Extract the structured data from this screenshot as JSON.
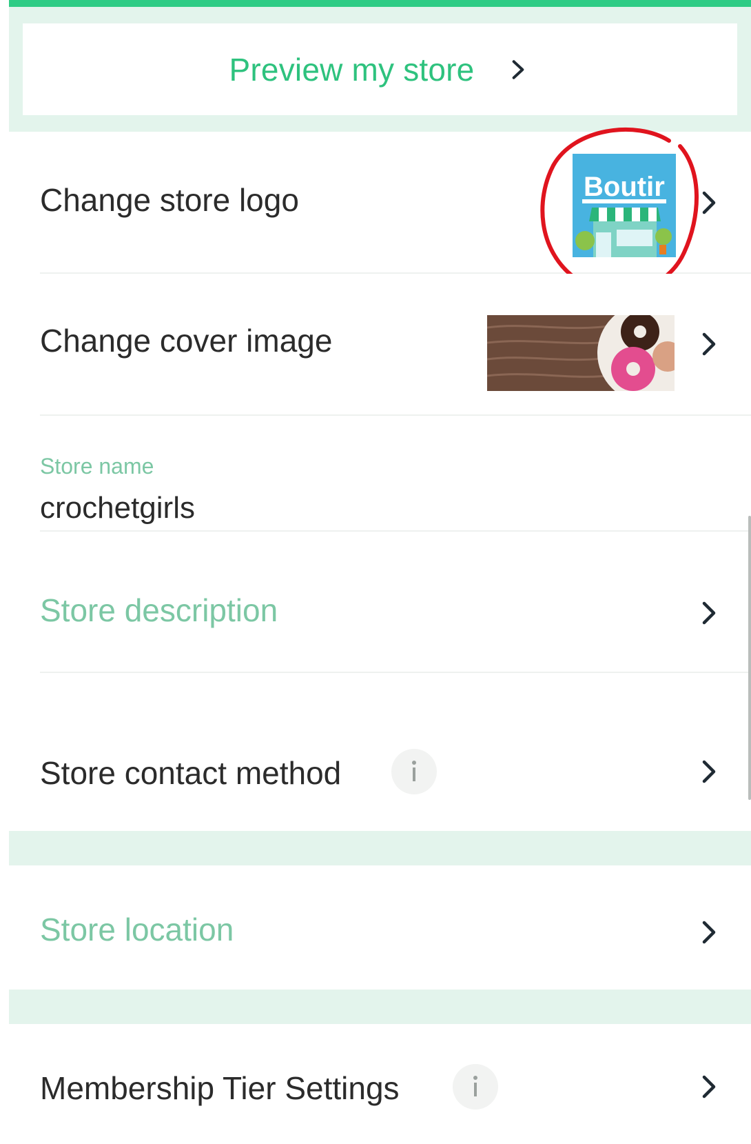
{
  "preview": {
    "label": "Preview my store"
  },
  "logo_row": {
    "label": "Change store logo",
    "logo_text": "Boutir"
  },
  "cover_row": {
    "label": "Change cover image"
  },
  "store_name": {
    "label": "Store name",
    "value": "crochetgirls"
  },
  "description_row": {
    "label": "Store description"
  },
  "contact_row": {
    "label": "Store contact method"
  },
  "location_row": {
    "label": "Store location"
  },
  "membership_row": {
    "label": "Membership Tier Settings"
  },
  "colors": {
    "accent_green": "#2ec27e",
    "muted_green": "#7cc7a4",
    "band_green": "#e3f4ec",
    "annotation_red": "#e0141e"
  },
  "icons": [
    "chevron-right-icon",
    "info-icon"
  ]
}
